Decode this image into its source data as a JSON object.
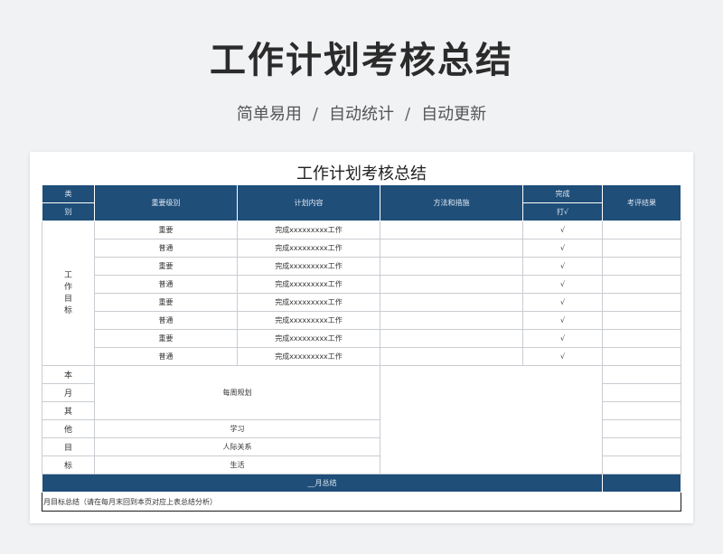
{
  "header": {
    "title": "工作计划考核总结",
    "subtitle_items": [
      "简单易用",
      "自动统计",
      "自动更新"
    ],
    "separator": "/"
  },
  "sheet": {
    "title": "工作计划考核总结",
    "columns": {
      "category_top": "类",
      "category_bottom": "别",
      "importance": "重要级别",
      "plan": "计划内容",
      "method": "方法和措施",
      "done_top": "完成",
      "done_bottom": "打√",
      "review": "考评结果"
    },
    "work_goal_label": [
      "工",
      "作",
      "目",
      "标"
    ],
    "work_rows": [
      {
        "importance": "重要",
        "plan": "完成xxxxxxxxx工作",
        "method": "",
        "done": "√",
        "review": ""
      },
      {
        "importance": "普通",
        "plan": "完成xxxxxxxxx工作",
        "method": "",
        "done": "√",
        "review": ""
      },
      {
        "importance": "重要",
        "plan": "完成xxxxxxxxx工作",
        "method": "",
        "done": "√",
        "review": ""
      },
      {
        "importance": "普通",
        "plan": "完成xxxxxxxxx工作",
        "method": "",
        "done": "√",
        "review": ""
      },
      {
        "importance": "重要",
        "plan": "完成xxxxxxxxx工作",
        "method": "",
        "done": "√",
        "review": ""
      },
      {
        "importance": "普通",
        "plan": "完成xxxxxxxxx工作",
        "method": "",
        "done": "√",
        "review": ""
      },
      {
        "importance": "重要",
        "plan": "完成xxxxxxxxx工作",
        "method": "",
        "done": "√",
        "review": ""
      },
      {
        "importance": "普通",
        "plan": "完成xxxxxxxxx工作",
        "method": "",
        "done": "√",
        "review": ""
      }
    ],
    "other_goal_label": [
      "本",
      "月",
      "其",
      "他",
      "目",
      "标"
    ],
    "other_rows": {
      "weekly": "每周规划",
      "study": "学习",
      "relations": "人际关系",
      "life": "生活"
    },
    "month_summary": "__月总结",
    "summary_note": "月目标总结（请在每月末回到本页对应上表总结分析）"
  }
}
